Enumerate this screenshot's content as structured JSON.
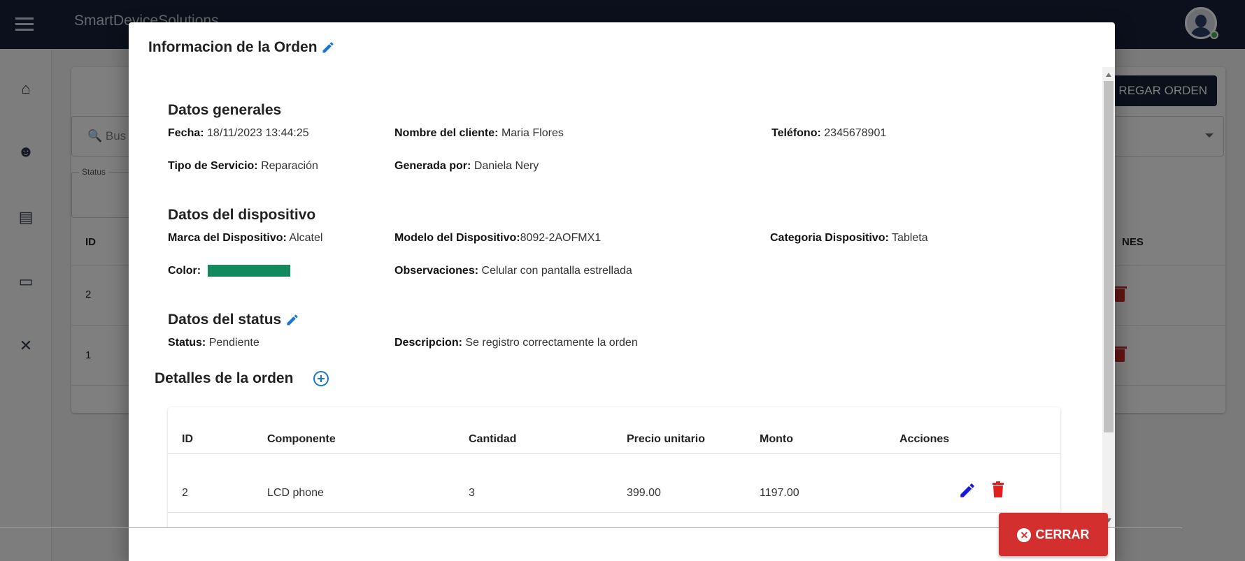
{
  "app": {
    "brand": "SmartDeviceSolutions"
  },
  "background": {
    "agregar_label": "REGAR ORDEN",
    "search_placeholder": "Bus",
    "status_label": "Status",
    "table_headers": {
      "id": "ID",
      "actions": "NES"
    },
    "rows": [
      {
        "id": "2"
      },
      {
        "id": "1"
      }
    ]
  },
  "dialog": {
    "title": "Informacion de la Orden",
    "general": {
      "title": "Datos generales",
      "fecha_label": "Fecha:",
      "fecha": "18/11/2023 13:44:25",
      "cliente_label": "Nombre del cliente:",
      "cliente": "Maria Flores",
      "telefono_label": "Teléfono:",
      "telefono": "2345678901",
      "servicio_label": "Tipo de Servicio:",
      "servicio": "Reparación",
      "generada_label": "Generada por:",
      "generada": "Daniela Nery"
    },
    "device": {
      "title": "Datos del dispositivo",
      "marca_label": "Marca del Dispositivo:",
      "marca": "Alcatel",
      "modelo_label": "Modelo del Dispositivo:",
      "modelo": "8092-2AOFMX1",
      "categoria_label": "Categoria Dispositivo:",
      "categoria": "Tableta",
      "color_label": "Color:",
      "color_value": "#128a5d",
      "observaciones_label": "Observaciones:",
      "observaciones": "Celular con pantalla estrellada"
    },
    "status": {
      "title": "Datos del status",
      "status_label": "Status:",
      "status": "Pendiente",
      "descripcion_label": "Descripcion:",
      "descripcion": "Se registro correctamente la orden"
    },
    "details": {
      "title": "Detalles de la orden",
      "headers": [
        "ID",
        "Componente",
        "Cantidad",
        "Precio unitario",
        "Monto",
        "Acciones"
      ],
      "rows": [
        {
          "id": "2",
          "componente": "LCD phone",
          "cantidad": "3",
          "precio": "399.00",
          "monto": "1197.00"
        }
      ]
    },
    "close_label": "CERRAR"
  },
  "icons": {
    "menu": "menu-icon",
    "home": "home-icon",
    "users": "users-icon",
    "orders": "clipboard-icon",
    "devices": "devices-icon",
    "tools": "tools-icon",
    "edit": "pencil-icon",
    "delete": "trash-icon",
    "add": "add-circle-icon",
    "close": "close-circle-icon"
  },
  "colors": {
    "topbar": "#162039",
    "accent": "#1976d2",
    "danger": "#d32f2f",
    "edit_blue": "#1a1ad6"
  }
}
